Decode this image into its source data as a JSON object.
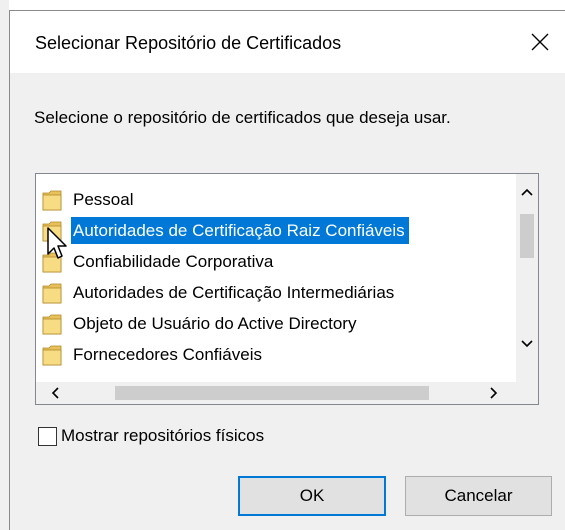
{
  "dialog": {
    "title": "Selecionar Repositório de Certificados",
    "instruction": "Selecione o repositório de certificados que deseja usar.",
    "close_icon": "close-icon"
  },
  "store_list": {
    "items": [
      {
        "label": "Pessoal",
        "selected": false
      },
      {
        "label": "Autoridades de Certificação Raiz Confiáveis",
        "selected": true
      },
      {
        "label": "Confiabilidade Corporativa",
        "selected": false
      },
      {
        "label": "Autoridades de Certificação Intermediárias",
        "selected": false
      },
      {
        "label": "Objeto de Usuário do Active Directory",
        "selected": false
      },
      {
        "label": "Fornecedores Confiáveis",
        "selected": false
      }
    ],
    "item_icon": "folder-icon",
    "selection_color": "#0078d7"
  },
  "show_physical": {
    "label": "Mostrar repositórios físicos",
    "checked": false
  },
  "buttons": {
    "ok_label": "OK",
    "cancel_label": "Cancelar"
  },
  "colors": {
    "dialog_background": "#f0f0f0",
    "accent": "#0078d7"
  }
}
